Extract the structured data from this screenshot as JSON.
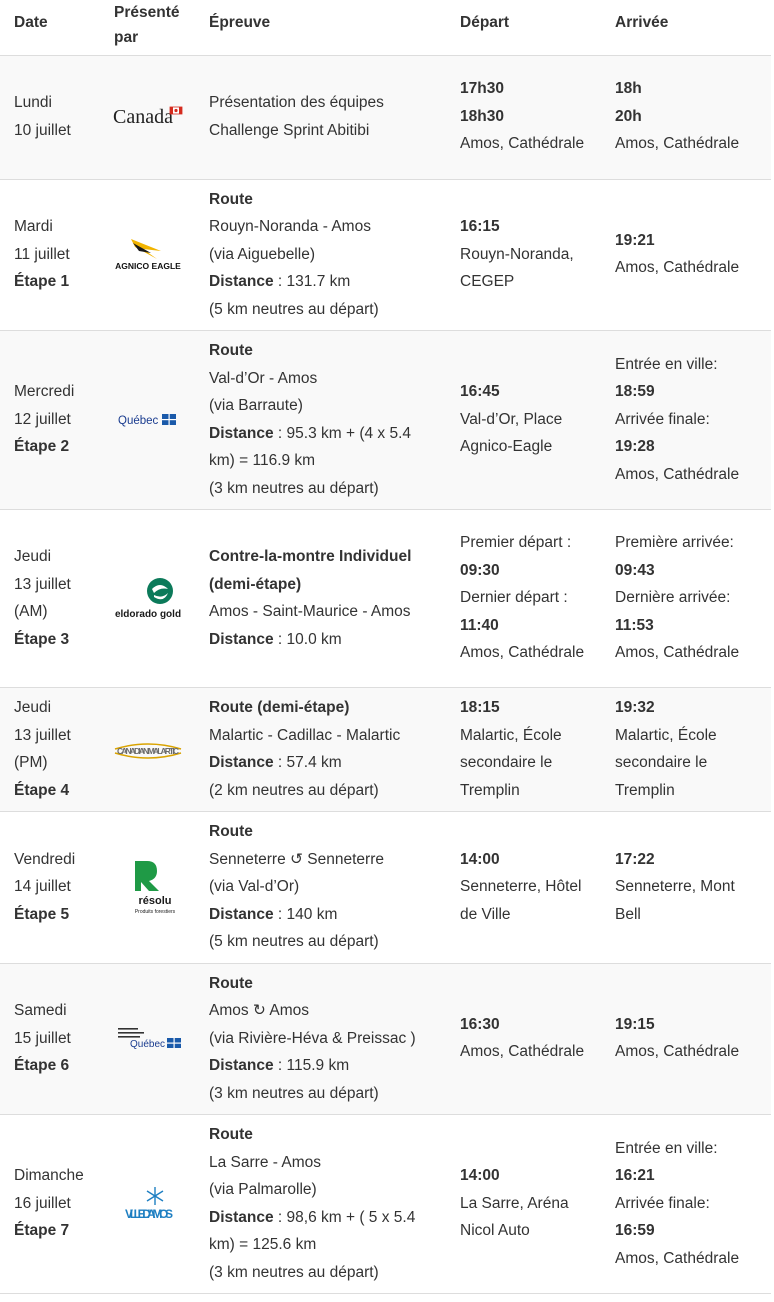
{
  "header": {
    "date": "Date",
    "presented_by": "Présenté par",
    "event": "Épreuve",
    "departure": "Départ",
    "arrival": "Arrivée"
  },
  "rows": [
    {
      "day": "Lundi",
      "date": "10 juillet",
      "stage": "",
      "sponsor": "Canada",
      "sponsor_icon": "canada-wordmark-icon",
      "event": [
        "Présentation des équipes",
        "Challenge Sprint Abitibi"
      ],
      "departure": {
        "times": [
          "17h30",
          "18h30"
        ],
        "place": "Amos, Cathédrale"
      },
      "arrival": {
        "times": [
          "18h",
          "20h"
        ],
        "place": "Amos, Cathédrale"
      }
    },
    {
      "day": "Mardi",
      "date": "11 juillet",
      "stage": "Étape 1",
      "sponsor": "AGNICO EAGLE",
      "sponsor_icon": "agnico-eagle-logo-icon",
      "event_type": "Route",
      "route": "Rouyn-Noranda - Amos",
      "via": "(via Aiguebelle)",
      "distance_label": "Distance",
      "distance": " : 131.7 km",
      "neutral": "(5 km neutres au départ)",
      "departure": {
        "time": "16:15",
        "place": "Rouyn-Noranda, CEGEP"
      },
      "arrival": {
        "time": "19:21",
        "place": "Amos, Cathédrale"
      }
    },
    {
      "day": "Mercredi",
      "date": "12 juillet",
      "stage": "Étape 2",
      "sponsor": "Québec",
      "sponsor_icon": "quebec-logo-icon",
      "event_type": "Route",
      "route": "Val-d’Or - Amos",
      "via": "(via Barraute)",
      "distance_label": "Distance",
      "distance": " : 95.3 km + (4 x 5.4 km) = 116.9 km",
      "neutral": "(3 km neutres au départ)",
      "departure": {
        "time": "16:45",
        "place": "Val-d’Or, Place Agnico-Eagle"
      },
      "arrival": {
        "city_label": "Entrée en ville:",
        "city_time": "18:59",
        "final_label": "Arrivée finale:",
        "final_time": "19:28",
        "place": "Amos, Cathédrale"
      }
    },
    {
      "day": "Jeudi",
      "date": "13 juillet",
      "half": "(AM)",
      "stage": "Étape 3",
      "sponsor": "eldorado gold",
      "sponsor_icon": "eldorado-gold-logo-icon",
      "event_type": "Contre-la-montre Individuel (demi-étape)",
      "route": "Amos - Saint-Maurice - Amos",
      "distance_label": "Distance",
      "distance": " : 10.0 km",
      "departure": {
        "first_label": "Premier départ :",
        "first_time": "09:30",
        "last_label": "Dernier départ :",
        "last_time": "11:40",
        "place": "Amos, Cathédrale"
      },
      "arrival": {
        "first_label": "Première arrivée:",
        "first_time": "09:43",
        "last_label": "Dernière arrivée:",
        "last_time": "11:53",
        "place": "Amos, Cathédrale"
      }
    },
    {
      "day": "Jeudi",
      "date": "13 juillet",
      "half": "(PM)",
      "stage": "Étape 4",
      "sponsor": "CANADIAN MALARTIC",
      "sponsor_icon": "canadian-malartic-logo-icon",
      "event_type": "Route (demi-étape)",
      "route": "Malartic - Cadillac - Malartic",
      "distance_label": "Distance",
      "distance": " : 57.4 km",
      "neutral": "(2 km neutres au départ)",
      "departure": {
        "time": "18:15",
        "place": "Malartic, École secondaire le Tremplin"
      },
      "arrival": {
        "time": "19:32",
        "place": "Malartic, École secondaire le Tremplin"
      }
    },
    {
      "day": "Vendredi",
      "date": "14 juillet",
      "stage": "Étape 5",
      "sponsor": "résolu",
      "sponsor_sub": "Produits forestiers",
      "sponsor_icon": "resolu-logo-icon",
      "event_type": "Route",
      "route": "Senneterre ↺ Senneterre",
      "via": "(via Val-d’Or)",
      "distance_label": "Distance",
      "distance": " : 140 km",
      "neutral": "(5 km neutres au départ)",
      "departure": {
        "time": "14:00",
        "place": "Senneterre, Hôtel de Ville"
      },
      "arrival": {
        "time": "17:22",
        "place": "Senneterre, Mont Bell"
      }
    },
    {
      "day": "Samedi",
      "date": "15 juillet",
      "stage": "Étape 6",
      "sponsor": "Québec",
      "sponsor_icon": "quebec-health-centre-logo-icon",
      "event_type": "Route",
      "route": "Amos ↻ Amos",
      "via": "(via Rivière-Héva & Preissac )",
      "distance_label": "Distance",
      "distance": " : 115.9 km",
      "neutral": "(3 km neutres au départ)",
      "departure": {
        "time": "16:30",
        "place": "Amos, Cathédrale"
      },
      "arrival": {
        "time": "19:15",
        "place": "Amos, Cathédrale"
      }
    },
    {
      "day": "Dimanche",
      "date": "16 juillet",
      "stage": "Étape 7",
      "sponsor": "VILLE D'AMOS",
      "sponsor_icon": "ville-amos-logo-icon",
      "event_type": "Route",
      "route": "La Sarre - Amos",
      "via": "(via Palmarolle)",
      "distance_label": "Distance",
      "distance": " : 98,6 km + ( 5 x 5.4 km) = 125.6 km",
      "neutral": "(3 km neutres au départ)",
      "departure": {
        "time": "14:00",
        "place": "La Sarre, Aréna Nicol Auto"
      },
      "arrival": {
        "city_label": "Entrée en ville:",
        "city_time": "16:21",
        "final_label": "Arrivée finale:",
        "final_time": "16:59",
        "place": "Amos, Cathédrale"
      }
    }
  ]
}
